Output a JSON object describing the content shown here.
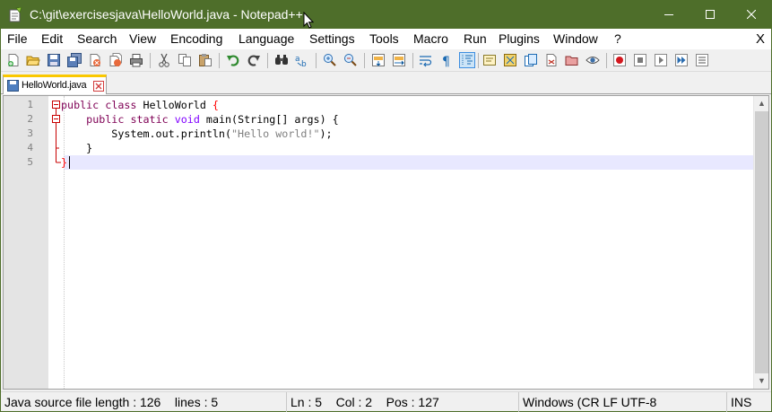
{
  "window": {
    "title": "C:\\git\\exercisesjava\\HelloWorld.java - Notepad++",
    "icons": {
      "app": "notepad-icon",
      "minimize": "minimize-icon",
      "maximize": "maximize-icon",
      "close": "close-icon"
    },
    "titlebar_color": "#4e6e2a"
  },
  "menubar": {
    "items": [
      "File",
      "Edit",
      "Search",
      "View",
      "Encoding",
      "Language",
      "Settings",
      "Tools",
      "Macro",
      "Run",
      "Plugins",
      "Window",
      "?"
    ],
    "close_label": "X"
  },
  "toolbar": {
    "buttons": [
      "new-file",
      "open-file",
      "save",
      "save-all",
      "close",
      "close-all",
      "print",
      "cut",
      "copy",
      "paste",
      "undo",
      "redo",
      "find",
      "replace",
      "zoom-in",
      "zoom-out",
      "sync-vertical",
      "sync-horizontal",
      "word-wrap",
      "show-all-characters",
      "indent-guide",
      "user-defined-language",
      "document-map",
      "function-list",
      "folder-as-workspace",
      "monitoring",
      "start-recording",
      "stop-recording",
      "playback",
      "run-multiple",
      "save-macro"
    ],
    "active": [
      "indent-guide"
    ]
  },
  "tab": {
    "label": "HelloWorld.java",
    "icon": "saved-file-icon",
    "close_icon": "tab-close-icon",
    "accent": "#fac800"
  },
  "editor": {
    "line_numbers": [
      "1",
      "2",
      "3",
      "4",
      "5"
    ],
    "code": {
      "l1_kw1": "public",
      "l1_kw2": "class",
      "l1_name": " HelloWorld ",
      "l1_brace": "{",
      "l2_kw1": "public",
      "l2_kw2": "static",
      "l2_kw3": "void",
      "l2_rest": " main(String[] args) ",
      "l2_brace": "{",
      "l3_pre": "System.out.println(",
      "l3_str": "\"Hello world!\"",
      "l3_post": ");",
      "l4": "}",
      "l5": "}"
    },
    "current_line_color": "#e8e8ff"
  },
  "statusbar": {
    "file_info": "Java source file length : 126",
    "lines": "lines : 5",
    "ln": "Ln : 5",
    "col": "Col : 2",
    "pos": "Pos : 127",
    "eol_encoding": "Windows (CR LF  UTF-8",
    "mode": "INS"
  }
}
